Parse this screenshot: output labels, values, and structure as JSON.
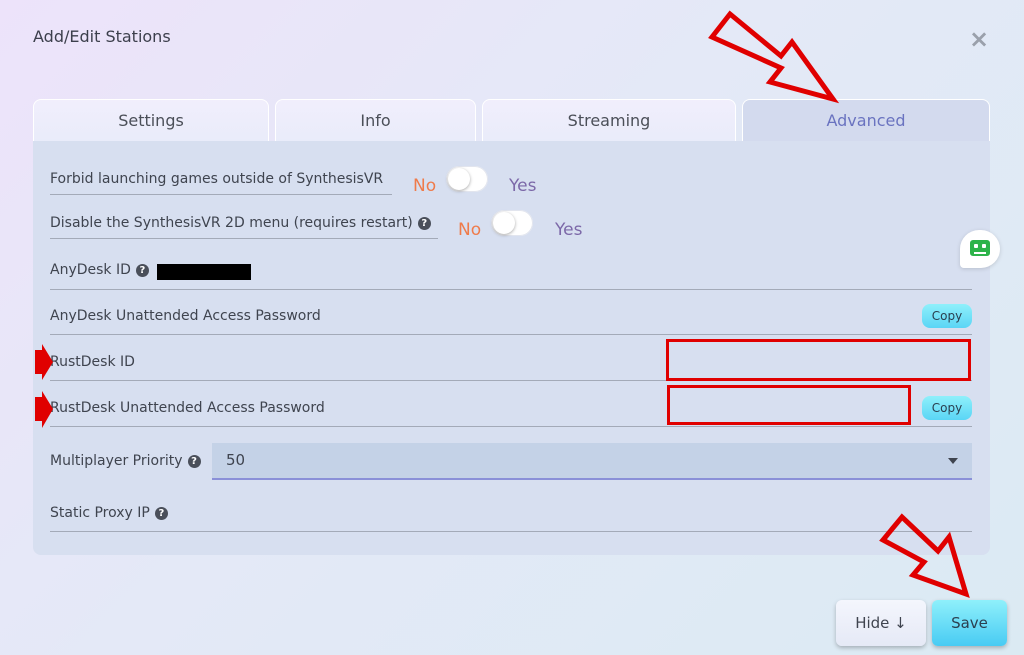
{
  "dialog": {
    "title": "Add/Edit Stations",
    "close_glyph": "×"
  },
  "tabs": [
    {
      "label": "Settings",
      "active": false
    },
    {
      "label": "Info",
      "active": false
    },
    {
      "label": "Streaming",
      "active": false
    },
    {
      "label": "Advanced",
      "active": true
    }
  ],
  "advanced": {
    "forbid_launch": {
      "label": "Forbid launching games outside of SynthesisVR",
      "no": "No",
      "yes": "Yes",
      "value": "No"
    },
    "disable_menu": {
      "label": "Disable the SynthesisVR 2D menu (requires restart)",
      "no": "No",
      "yes": "Yes",
      "value": "No"
    },
    "anydesk_id": {
      "label": "AnyDesk ID"
    },
    "anydesk_password": {
      "label": "AnyDesk Unattended Access Password",
      "copy": "Copy"
    },
    "rustdesk_id": {
      "label": "RustDesk ID"
    },
    "rustdesk_password": {
      "label": "RustDesk Unattended Access Password",
      "copy": "Copy"
    },
    "multiplayer_priority": {
      "label": "Multiplayer Priority",
      "value": "50"
    },
    "static_proxy_ip": {
      "label": "Static Proxy IP"
    }
  },
  "footer": {
    "hide_label": "Hide ↓",
    "save_label": "Save"
  },
  "colors": {
    "annotation_red": "#e00000",
    "no_color": "#ef7b4a",
    "yes_color": "#7c68a8",
    "accent_cyan": "#5ad5f5",
    "active_tab_text": "#6a73c0"
  },
  "icons": [
    "close-icon",
    "help-icon",
    "chevron-down-icon",
    "chat-bot-icon",
    "arrow-annotation-icon"
  ]
}
